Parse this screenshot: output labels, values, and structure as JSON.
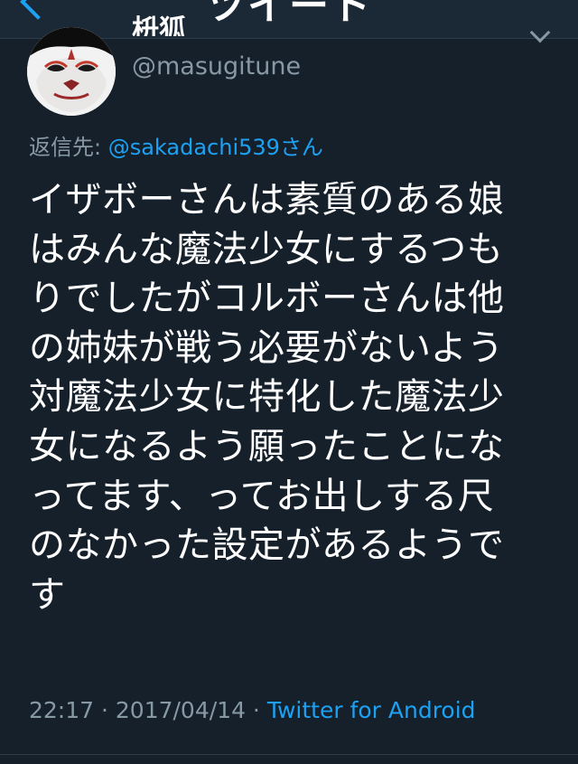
{
  "nav": {
    "title": "ツイート"
  },
  "author": {
    "display_name": "枡狐",
    "handle": "@masugitune"
  },
  "reply": {
    "label": "返信先: ",
    "mention": "@sakadachi539",
    "suffix": "さん"
  },
  "tweet": {
    "lines": [
      "イザボーさんは素質のある娘",
      "はみんな魔法少女にするつも",
      "りでしたがコルボーさんは他",
      "の姉妹が戦う必要がないよう",
      "対魔法少女に特化した魔法少",
      "女になるよう願ったことにな",
      "ってます、ってお出しする尺",
      "のなかった設定があるようで",
      "す"
    ]
  },
  "meta": {
    "time": "22:17",
    "separator": " · ",
    "date": "2017/04/14",
    "separator2": " · ",
    "source": "Twitter for Android"
  },
  "icons": {
    "back": "chevron-left-icon",
    "more": "chevron-down-icon"
  },
  "colors": {
    "background": "#15202b",
    "accent": "#1da1f2",
    "secondary_text": "#8899a6",
    "primary_text": "#ffffff"
  }
}
